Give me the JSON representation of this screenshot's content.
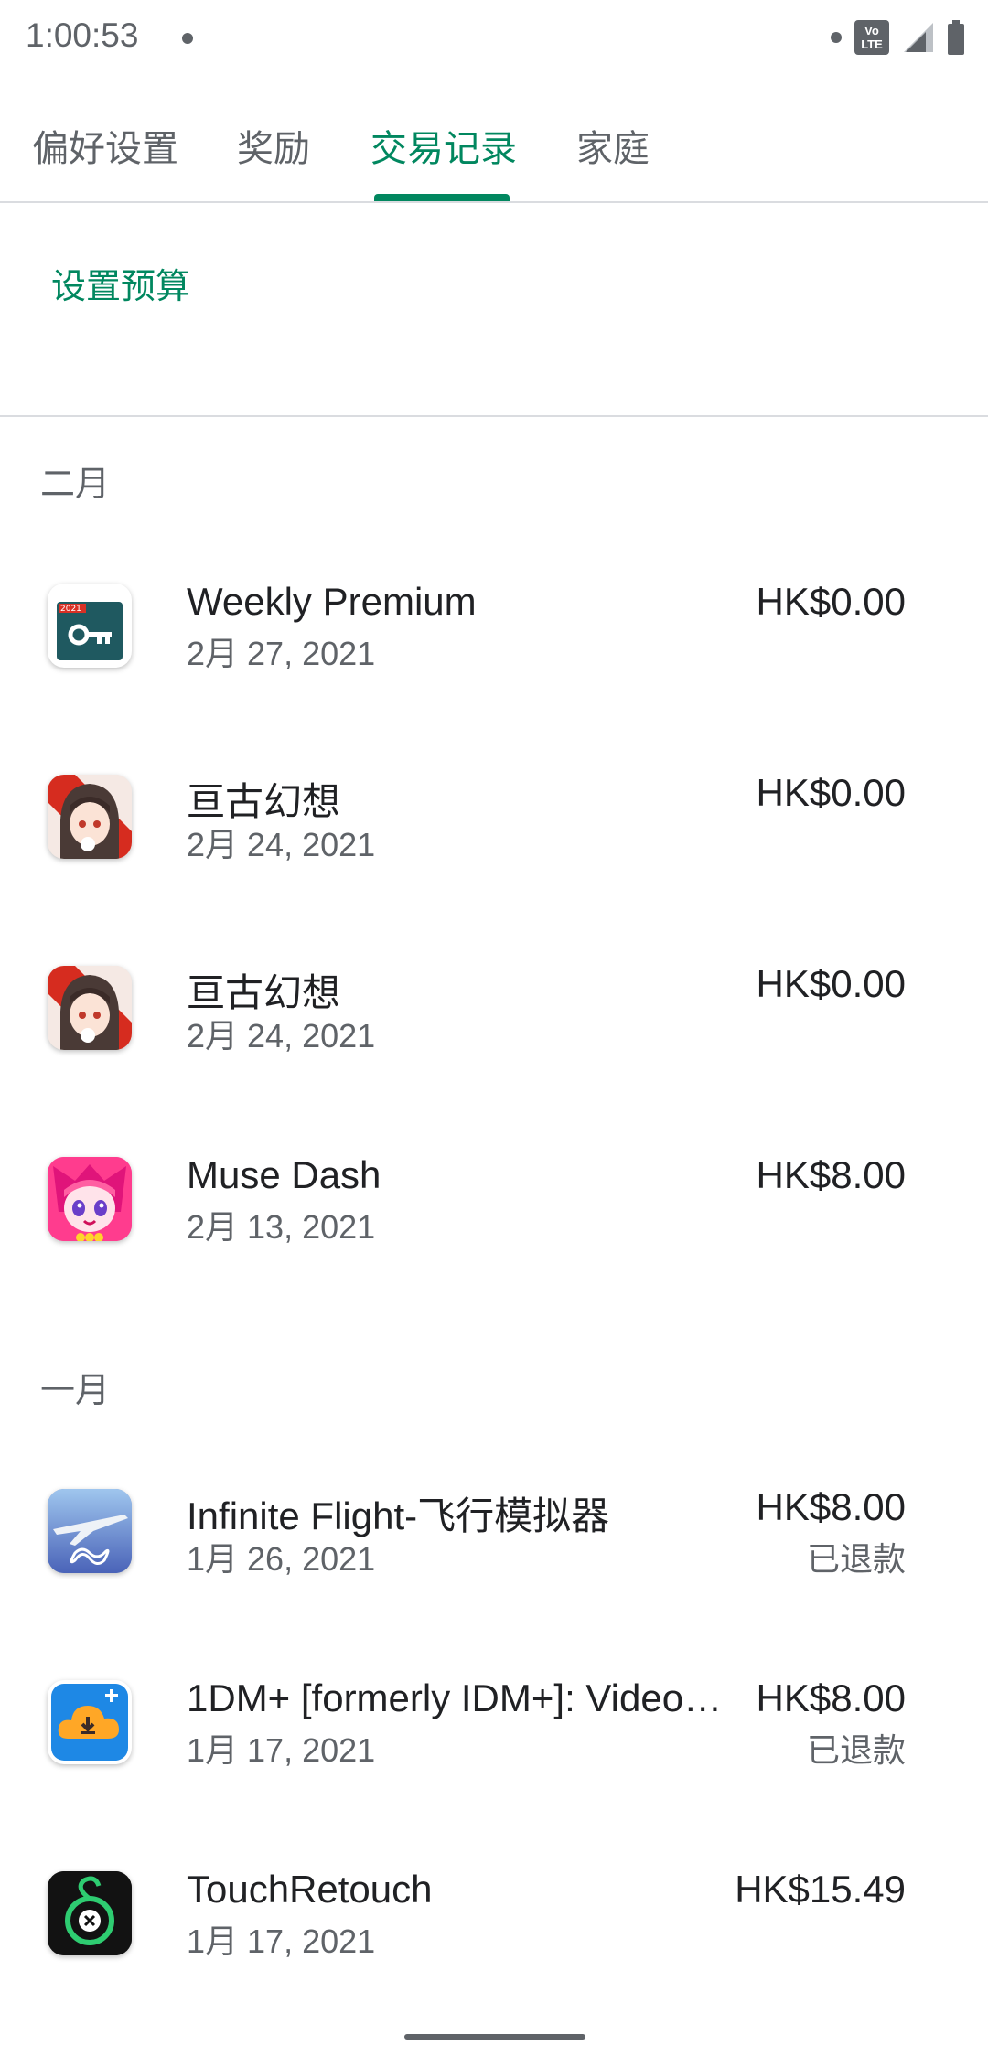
{
  "status_bar": {
    "time": "1:00:53",
    "volte_label_top": "Vo",
    "volte_label_bottom": "LTE",
    "icons": [
      "notification-dot-icon",
      "volte-icon",
      "signal-icon",
      "battery-icon"
    ]
  },
  "tabs": [
    {
      "label": "偏好设置",
      "active": false
    },
    {
      "label": "奖励",
      "active": false
    },
    {
      "label": "交易记录",
      "active": true
    },
    {
      "label": "家庭",
      "active": false
    }
  ],
  "accent_color": "#01875f",
  "budget_link": "设置预算",
  "sections": [
    {
      "month": "二月",
      "items": [
        {
          "title": "Weekly Premium",
          "date": "2月 27, 2021",
          "price": "HK$0.00",
          "status": "",
          "icon": "vpn-key-app-icon",
          "icon_badge": "2021"
        },
        {
          "title": "亘古幻想",
          "date": "2月 24, 2021",
          "price": "HK$0.00",
          "status": "",
          "icon": "anime-girl-app-icon"
        },
        {
          "title": "亘古幻想",
          "date": "2月 24, 2021",
          "price": "HK$0.00",
          "status": "",
          "icon": "anime-girl-app-icon"
        },
        {
          "title": "Muse Dash",
          "date": "2月 13, 2021",
          "price": "HK$8.00",
          "status": "",
          "icon": "muse-dash-app-icon"
        }
      ]
    },
    {
      "month": "一月",
      "items": [
        {
          "title": "Infinite Flight-飞行模拟器",
          "date": "1月 26, 2021",
          "price": "HK$8.00",
          "status": "已退款",
          "icon": "airplane-app-icon"
        },
        {
          "title": "1DM+ [formerly IDM+]: Video…",
          "date": "1月 17, 2021",
          "price": "HK$8.00",
          "status": "已退款",
          "icon": "download-cloud-app-icon"
        },
        {
          "title": "TouchRetouch",
          "date": "1月 17, 2021",
          "price": "HK$15.49",
          "status": "",
          "icon": "touchretouch-app-icon"
        }
      ]
    }
  ]
}
